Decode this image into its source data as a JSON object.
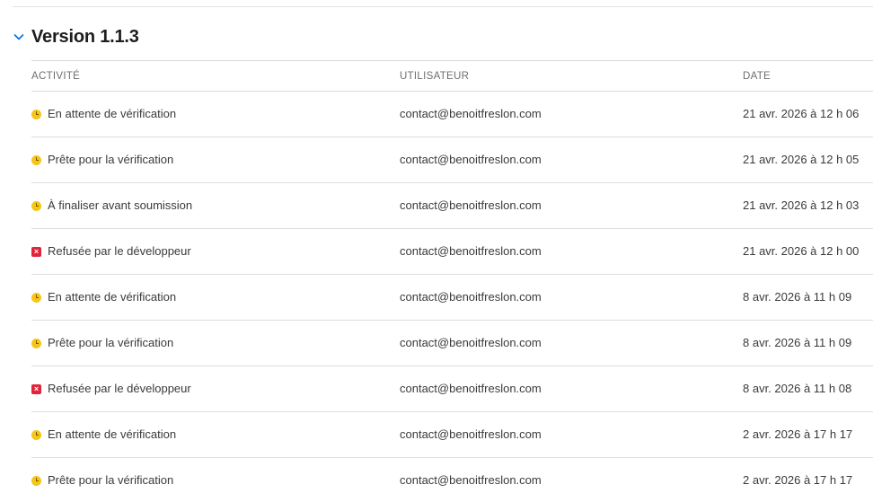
{
  "section": {
    "title": "Version 1.1.3",
    "collapse_icon": "chevron-down-icon"
  },
  "table": {
    "headers": {
      "activity": "ACTIVITÉ",
      "user": "UTILISATEUR",
      "date": "DATE"
    },
    "rows": [
      {
        "status": "pending",
        "status_icon": "clock-icon",
        "activity": "En attente de vérification",
        "user": "contact@benoitfreslon.com",
        "date": "21 avr. 2026 à 12 h 06"
      },
      {
        "status": "pending",
        "status_icon": "clock-icon",
        "activity": "Prête pour la vérification",
        "user": "contact@benoitfreslon.com",
        "date": "21 avr. 2026 à 12 h 05"
      },
      {
        "status": "pending",
        "status_icon": "clock-icon",
        "activity": "À finaliser avant soumission",
        "user": "contact@benoitfreslon.com",
        "date": "21 avr. 2026 à 12 h 03"
      },
      {
        "status": "rejected",
        "status_icon": "x-mark-icon",
        "activity": "Refusée par le développeur",
        "user": "contact@benoitfreslon.com",
        "date": "21 avr. 2026 à 12 h 00"
      },
      {
        "status": "pending",
        "status_icon": "clock-icon",
        "activity": "En attente de vérification",
        "user": "contact@benoitfreslon.com",
        "date": "8 avr. 2026 à 11 h 09"
      },
      {
        "status": "pending",
        "status_icon": "clock-icon",
        "activity": "Prête pour la vérification",
        "user": "contact@benoitfreslon.com",
        "date": "8 avr. 2026 à 11 h 09"
      },
      {
        "status": "rejected",
        "status_icon": "x-mark-icon",
        "activity": "Refusée par le développeur",
        "user": "contact@benoitfreslon.com",
        "date": "8 avr. 2026 à 11 h 08"
      },
      {
        "status": "pending",
        "status_icon": "clock-icon",
        "activity": "En attente de vérification",
        "user": "contact@benoitfreslon.com",
        "date": "2 avr. 2026 à 17 h 17"
      },
      {
        "status": "pending",
        "status_icon": "clock-icon",
        "activity": "Prête pour la vérification",
        "user": "contact@benoitfreslon.com",
        "date": "2 avr. 2026 à 17 h 17"
      }
    ]
  },
  "colors": {
    "pending": "#f5c518",
    "rejected": "#e0243a",
    "accent": "#0071e3"
  }
}
